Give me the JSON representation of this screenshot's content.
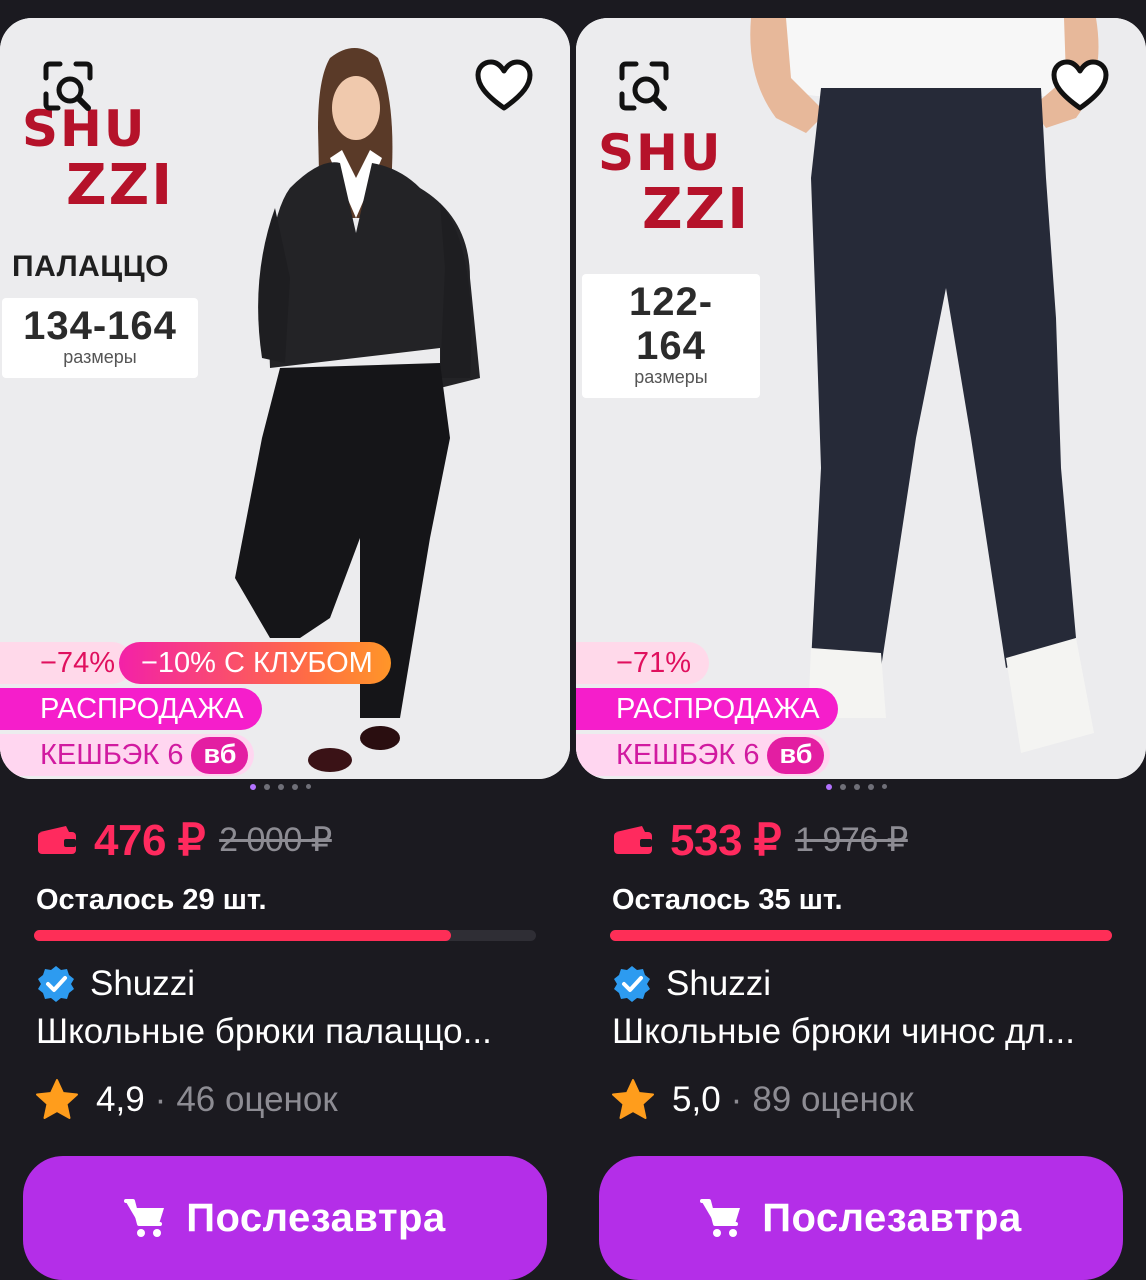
{
  "products": [
    {
      "brand_logo_lines": [
        "SHU",
        "ZZI"
      ],
      "style_name": "ПАЛАЦЦО",
      "size_range": "134-164",
      "size_caption": "размеры",
      "badges": {
        "discount": "−74%",
        "club": "−10% С КЛУБОМ",
        "sale": "РАСПРОДАЖА",
        "cashback": "КЕШБЭК 6",
        "cashback_unit": "вб"
      },
      "carousel_dots": 5,
      "carousel_active": 0,
      "price": "476 ₽",
      "old_price": "2 000 ₽",
      "stock_text": "Осталось 29 шт.",
      "stock_level": 0.83,
      "seller": "Shuzzi",
      "title": "Школьные брюки палаццо...",
      "rating": "4,9",
      "rating_separator": "·",
      "reviews": "46 оценок",
      "button_label": "Послезавтра"
    },
    {
      "brand_logo_lines": [
        "SHU",
        "ZZI"
      ],
      "style_name": "",
      "size_range": "122-164",
      "size_caption": "размеры",
      "badges": {
        "discount": "−71%",
        "club": "",
        "sale": "РАСПРОДАЖА",
        "cashback": "КЕШБЭК 6",
        "cashback_unit": "вб"
      },
      "carousel_dots": 5,
      "carousel_active": 0,
      "price": "533 ₽",
      "old_price": "1 976 ₽",
      "stock_text": "Осталось 35 шт.",
      "stock_level": 1.0,
      "seller": "Shuzzi",
      "title": "Школьные брюки чинос дл...",
      "rating": "5,0",
      "rating_separator": "·",
      "reviews": "89 оценок",
      "button_label": "Послезавтра"
    }
  ],
  "colors": {
    "background": "#1b1a20",
    "price": "#ff2a5e",
    "stock_bar": "#fe2e57",
    "button": "#b42ee8",
    "logo": "#b5122a"
  },
  "icons": {
    "image_search": "image-search-icon",
    "favorite": "heart-outline-icon",
    "wallet": "wallet-icon",
    "verified": "verified-check-icon",
    "rating": "star-icon",
    "cart": "cart-icon"
  }
}
